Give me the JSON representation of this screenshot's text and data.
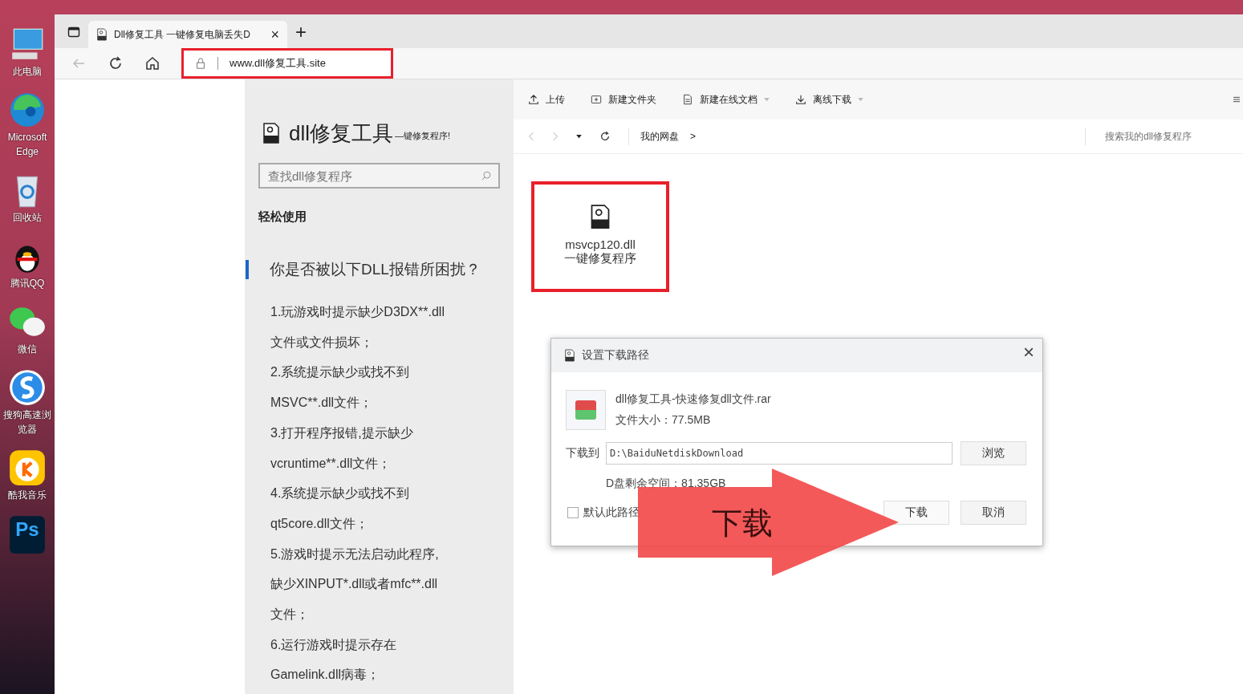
{
  "desktop": {
    "icons": [
      {
        "kind": "pc",
        "label": "此电脑"
      },
      {
        "kind": "edge",
        "label": "Microsoft Edge"
      },
      {
        "kind": "bin",
        "label": "回收站"
      },
      {
        "kind": "qq",
        "label": "腾讯QQ"
      },
      {
        "kind": "wechat",
        "label": "微信"
      },
      {
        "kind": "sogou",
        "label": "搜狗高速浏览器"
      },
      {
        "kind": "kuwo",
        "label": "酷我音乐"
      },
      {
        "kind": "ps",
        "label": "Ps"
      }
    ]
  },
  "browser": {
    "tab": {
      "title": "Dll修复工具 一键修复电脑丢失D",
      "close": "×"
    },
    "new_tab": "+",
    "address": "www.dll修复工具.site"
  },
  "sidebar": {
    "logo": "dll修复工具",
    "slogan": "—键修复程序!",
    "search": {
      "placeholder": "查找dll修复程序"
    },
    "section": "轻松使用",
    "question": "你是否被以下DLL报错所困扰？",
    "items": [
      {
        "lines": [
          "1.玩游戏时提示缺少D3DX**.dll",
          "文件或文件损坏；"
        ]
      },
      {
        "lines": [
          "2.系统提示缺少或找不到",
          "MSVC**.dll文件；"
        ]
      },
      {
        "lines": [
          "3.打开程序报错,提示缺少",
          "vcruntime**.dll文件；"
        ]
      },
      {
        "lines": [
          "4.系统提示缺少或找不到",
          "qt5core.dll文件；"
        ]
      },
      {
        "lines": [
          "5.游戏时提示无法启动此程序,",
          "缺少XINPUT*.dll或者mfc**.dll",
          "文件；"
        ]
      },
      {
        "lines": [
          "6.运行游戏时提示存在",
          "Gamelink.dll病毒；"
        ]
      }
    ]
  },
  "toolbar": [
    {
      "kind": "upload",
      "label": "上传",
      "dropdown": false
    },
    {
      "kind": "folder",
      "label": "新建文件夹",
      "dropdown": false
    },
    {
      "kind": "doc",
      "label": "新建在线文档",
      "dropdown": true
    },
    {
      "kind": "download",
      "label": "离线下载",
      "dropdown": true
    }
  ],
  "breadcrumb": {
    "root": "我的网盘",
    "separator": ">"
  },
  "file_search": {
    "placeholder": "搜索我的dll修复程序"
  },
  "files": [
    {
      "name": "msvcp120.dll",
      "subtitle": "一键修复程序",
      "highlighted": true
    }
  ],
  "dialog": {
    "title": "设置下载路径",
    "close": "×",
    "file_name": "dll修复工具-快速修复dll文件.rar",
    "file_size": "文件大小：77.5MB",
    "path_label": "下载到",
    "path": "D:\\BaiduNetdiskDownload",
    "browse": "浏览",
    "free_space": "D盘剩余空间：81.35GB",
    "default_checkbox": {
      "label": "默认此路径",
      "checked": false
    },
    "buttons": [
      {
        "kind": "primary",
        "label": "下载"
      },
      {
        "kind": "cancel",
        "label": "取消"
      }
    ]
  },
  "callout": {
    "text": "下载"
  }
}
